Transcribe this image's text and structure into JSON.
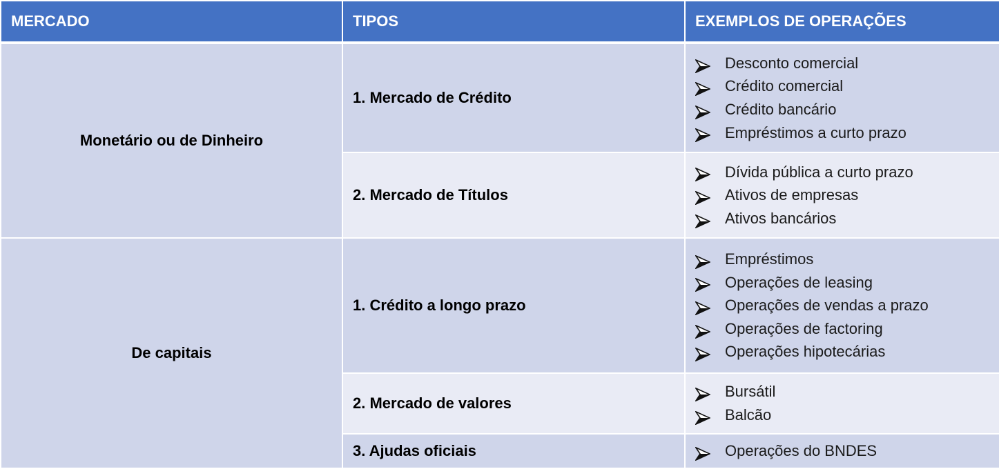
{
  "headers": {
    "mercado": "MERCADO",
    "tipos": "TIPOS",
    "exemplos": "EXEMPLOS DE OPERAÇÕES"
  },
  "bullet_icon": "arrowhead-bullet-icon",
  "colors": {
    "header_bg": "#4472c4",
    "row_dark": "#cfd5ea",
    "row_light": "#e9ebf5"
  },
  "markets": [
    {
      "name": "Monetário ou de Dinheiro",
      "types": [
        {
          "label": "1. Mercado de Crédito",
          "operations": [
            "Desconto comercial",
            "Crédito comercial",
            "Crédito bancário",
            "Empréstimos a curto prazo"
          ]
        },
        {
          "label": "2. Mercado de Títulos",
          "operations": [
            "Dívida pública a curto prazo",
            "Ativos de empresas",
            "Ativos bancários"
          ]
        }
      ]
    },
    {
      "name": "De capitais",
      "types": [
        {
          "label": "1. Crédito a longo prazo",
          "operations": [
            "Empréstimos",
            "Operações de leasing",
            "Operações de vendas a prazo",
            "Operações de factoring",
            "Operações hipotecárias"
          ]
        },
        {
          "label": "2. Mercado de valores",
          "operations": [
            "Bursátil",
            "Balcão"
          ]
        },
        {
          "label": "3. Ajudas oficiais",
          "operations": [
            "Operações do BNDES"
          ]
        }
      ]
    }
  ]
}
